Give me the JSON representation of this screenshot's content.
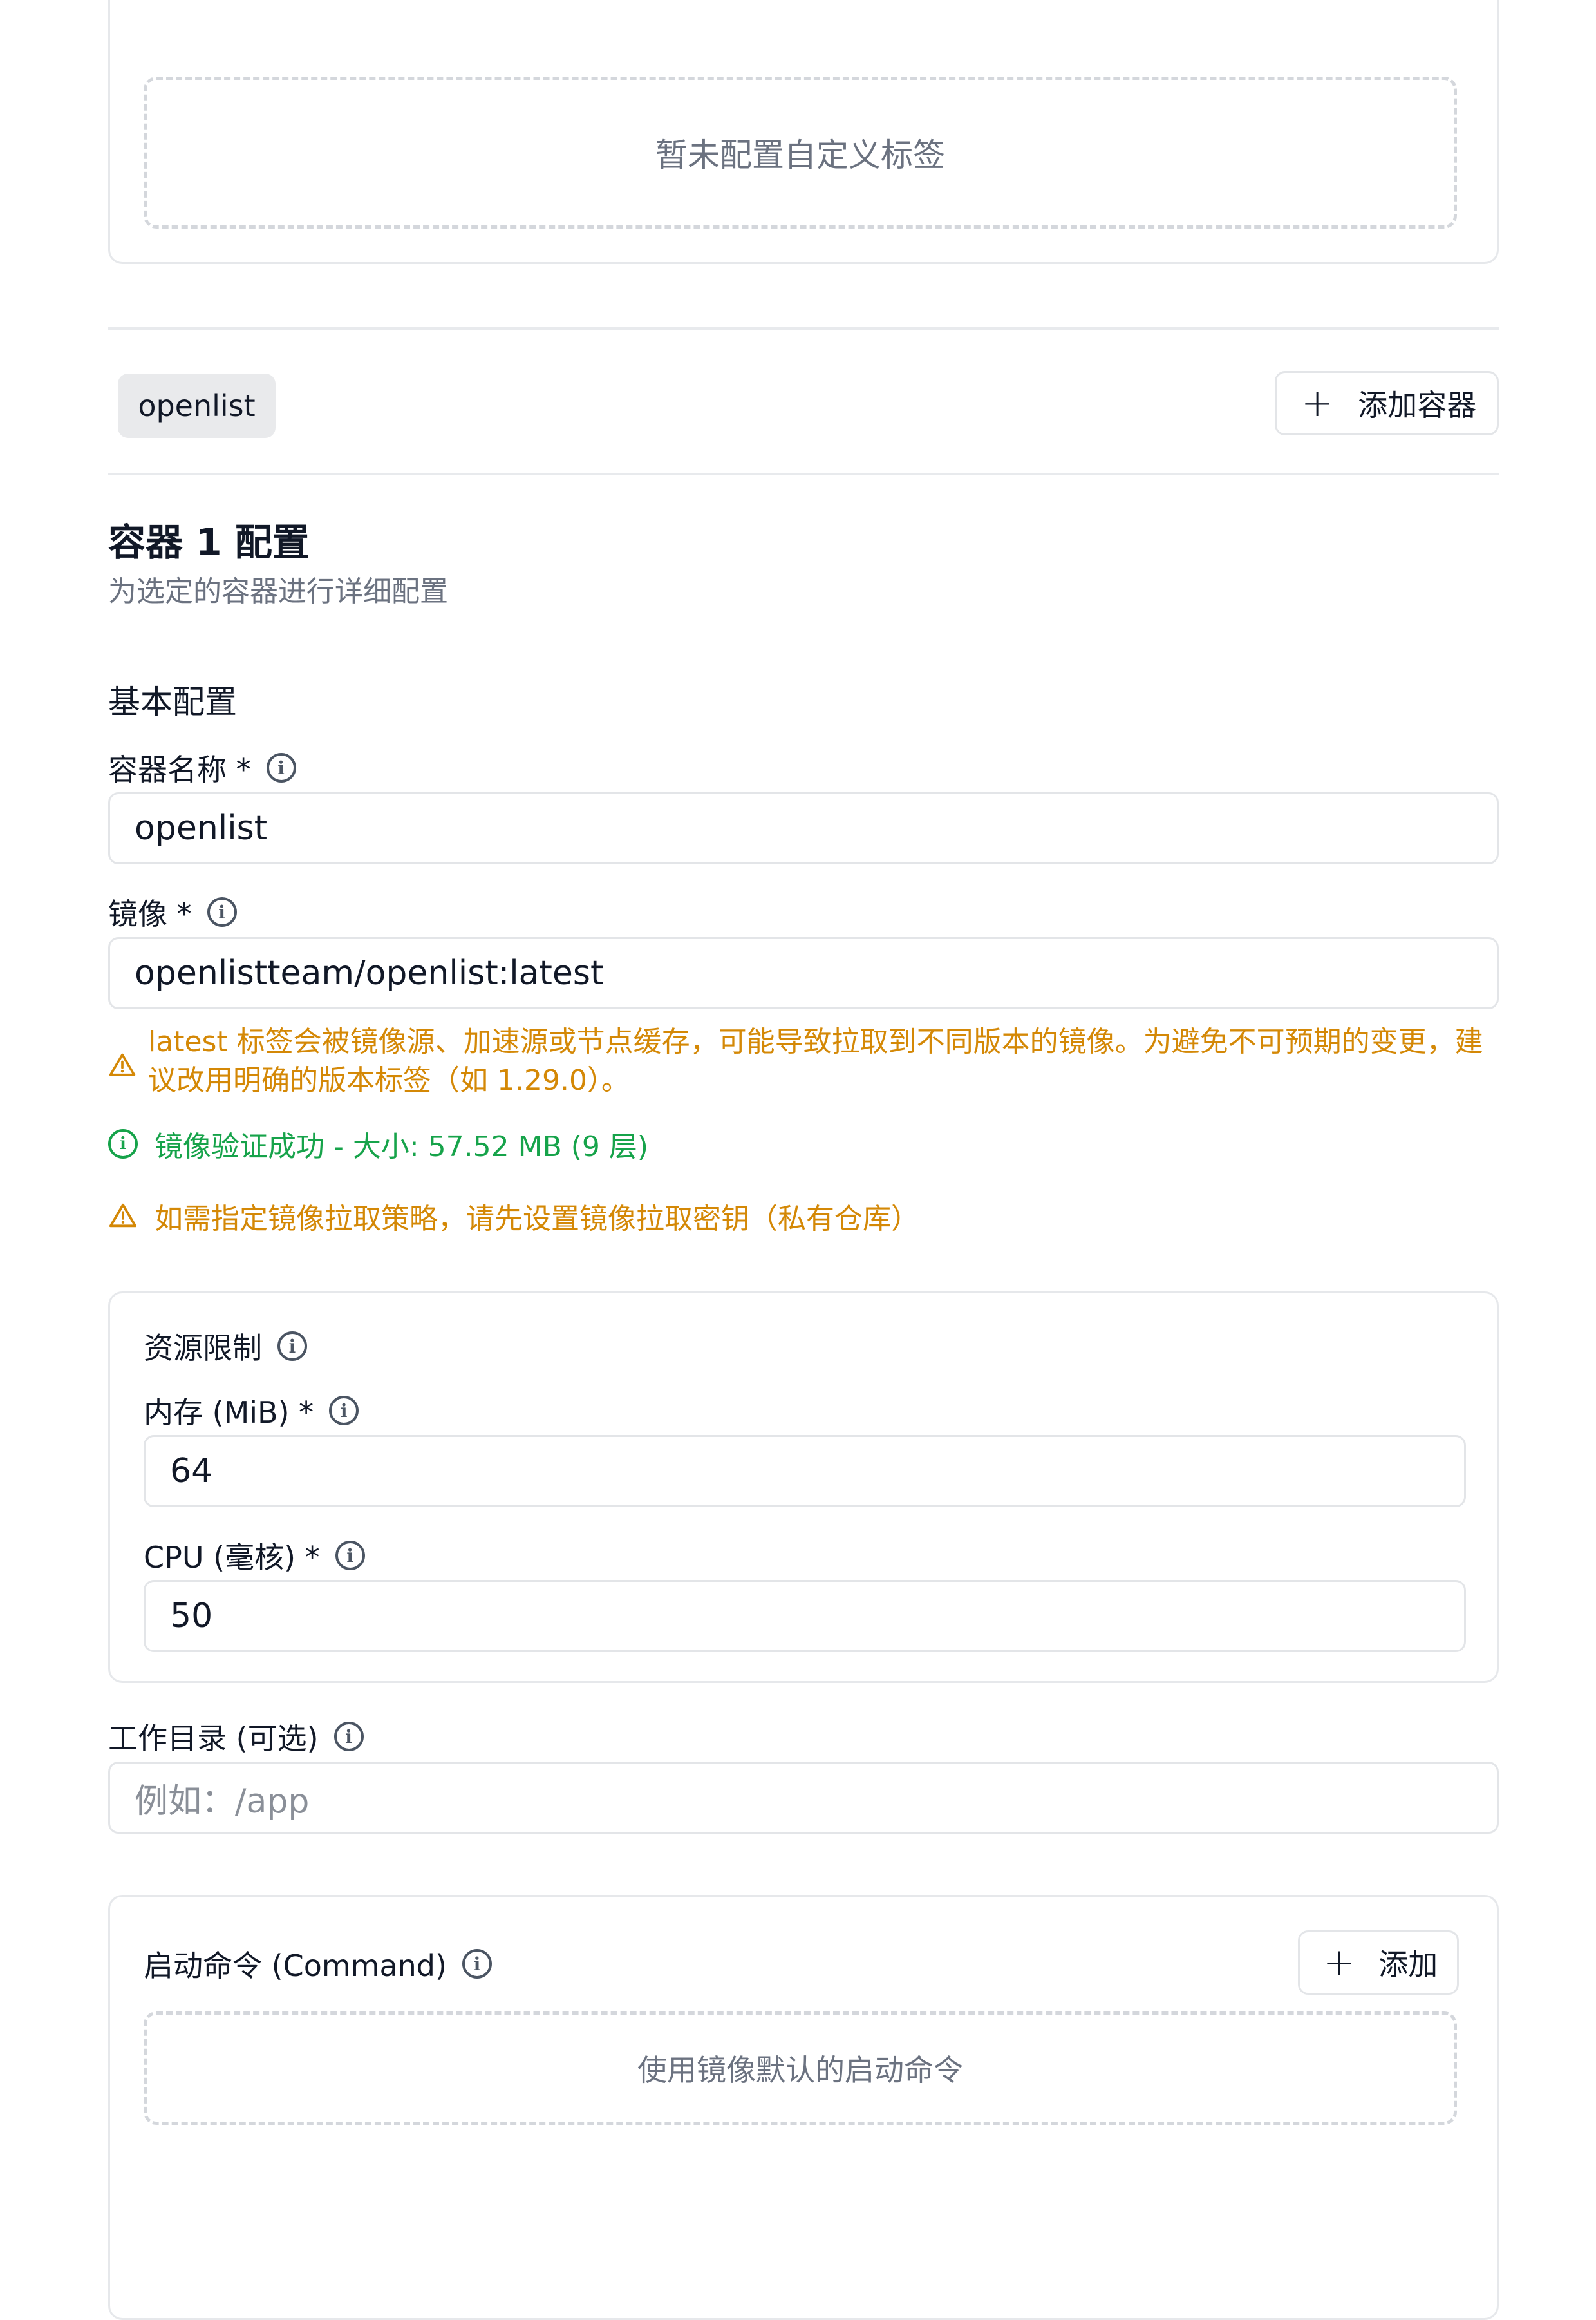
{
  "custom_tags": {
    "empty_text": "暂未配置自定义标签"
  },
  "container_tabs": {
    "items": [
      "openlist"
    ],
    "add_button_label": "添加容器"
  },
  "config": {
    "title": "容器 1 配置",
    "subtitle": "为选定的容器进行详细配置",
    "basic_heading": "基本配置",
    "name_label": "容器名称 *",
    "name_value": "openlist",
    "image_label": "镜像 *",
    "image_value": "openlistteam/openlist:latest",
    "latest_warning_line1": "latest 标签会被镜像源、加速源或节点缓存，可能导致拉取到不同版本的镜像。为避免不可预期的变更，建",
    "latest_warning_line2": "议改用明确的版本标签（如 1.29.0）。",
    "verify_success": "镜像验证成功 - 大小: 57.52 MB (9 层)",
    "pull_policy_warning": "如需指定镜像拉取策略，请先设置镜像拉取密钥（私有仓库）"
  },
  "resources": {
    "heading": "资源限制",
    "memory_label": "内存 (MiB) *",
    "memory_value": "64",
    "cpu_label": "CPU (毫核) *",
    "cpu_value": "50"
  },
  "workdir": {
    "label": "工作目录 (可选)",
    "placeholder": "例如：/app"
  },
  "command": {
    "label": "启动命令 (Command)",
    "add_button_label": "添加",
    "empty_text": "使用镜像默认的启动命令"
  },
  "colors": {
    "warning": "#d48806",
    "success": "#16a34a",
    "border": "#e3e5e8"
  }
}
